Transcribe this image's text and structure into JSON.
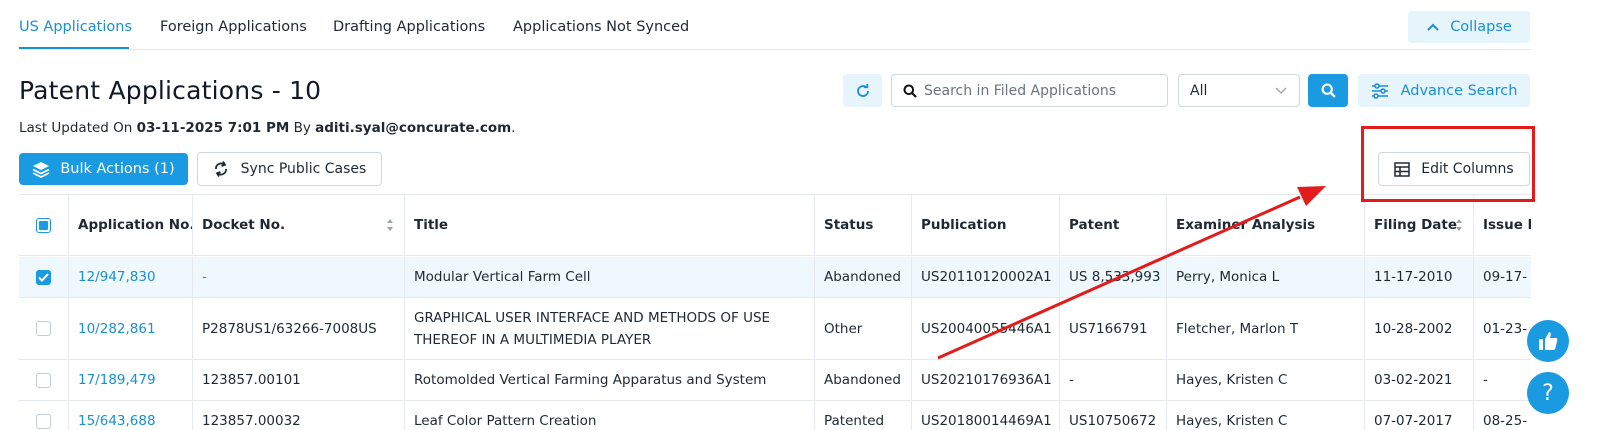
{
  "tabs": [
    {
      "label": "US Applications",
      "active": true
    },
    {
      "label": "Foreign Applications",
      "active": false
    },
    {
      "label": "Drafting Applications",
      "active": false
    },
    {
      "label": "Applications Not Synced",
      "active": false
    }
  ],
  "collapse_label": "Collapse",
  "title": "Patent Applications - 10",
  "last_updated": {
    "prefix": "Last Updated On ",
    "datetime": "03-11-2025 7:01 PM",
    "by": " By ",
    "user": "aditi.syal@concurate.com",
    "suffix": "."
  },
  "search": {
    "placeholder": "Search in Filed Applications",
    "value": ""
  },
  "filter_select": {
    "value": "All"
  },
  "advance_search_label": "Advance Search",
  "bulk_actions_label": "Bulk Actions (1)",
  "sync_label": "Sync Public Cases",
  "edit_columns_label": "Edit Columns",
  "table": {
    "columns": [
      "Application No.",
      "Docket No.",
      "Title",
      "Status",
      "Publication",
      "Patent",
      "Examiner Analysis",
      "Filing Date",
      "Issue D"
    ],
    "rows": [
      {
        "selected": true,
        "app_no": "12/947,830",
        "docket": "-",
        "title": "Modular Vertical Farm Cell",
        "status": "Abandoned",
        "publication": "US20110120002A1",
        "patent": "US 8,533,993",
        "examiner": "Perry, Monica L",
        "filing": "11-17-2010",
        "issue": "09-17-"
      },
      {
        "selected": false,
        "app_no": "10/282,861",
        "docket": "P2878US1/63266-7008US",
        "title": "GRAPHICAL USER INTERFACE AND METHODS OF USE THEREOF IN A MULTIMEDIA PLAYER",
        "status": "Other",
        "publication": "US20040055446A1",
        "patent": "US7166791",
        "examiner": "Fletcher, Marlon T",
        "filing": "10-28-2002",
        "issue": "01-23-"
      },
      {
        "selected": false,
        "app_no": "17/189,479",
        "docket": "123857.00101",
        "title": "Rotomolded Vertical Farming Apparatus and System",
        "status": "Abandoned",
        "publication": "US20210176936A1",
        "patent": "-",
        "examiner": "Hayes, Kristen C",
        "filing": "03-02-2021",
        "issue": "-"
      },
      {
        "selected": false,
        "app_no": "15/643,688",
        "docket": "123857.00032",
        "title": "Leaf Color Pattern Creation",
        "status": "Patented",
        "publication": "US20180014469A1",
        "patent": "US10750672",
        "examiner": "Hayes, Kristen C",
        "filing": "07-07-2017",
        "issue": "08-25-"
      }
    ]
  },
  "colors": {
    "accent": "#1a9ae0",
    "link": "#1a8fd6",
    "annotation": "#e31b1b"
  },
  "icons": {
    "collapse": "chevron-up-icon",
    "refresh": "refresh-icon",
    "search": "search-icon",
    "filter": "sliders-icon",
    "bulk": "layers-icon",
    "sync": "sync-icon",
    "edit_columns": "table-grid-icon",
    "like": "thumbs-up-icon",
    "help": "help-icon"
  }
}
